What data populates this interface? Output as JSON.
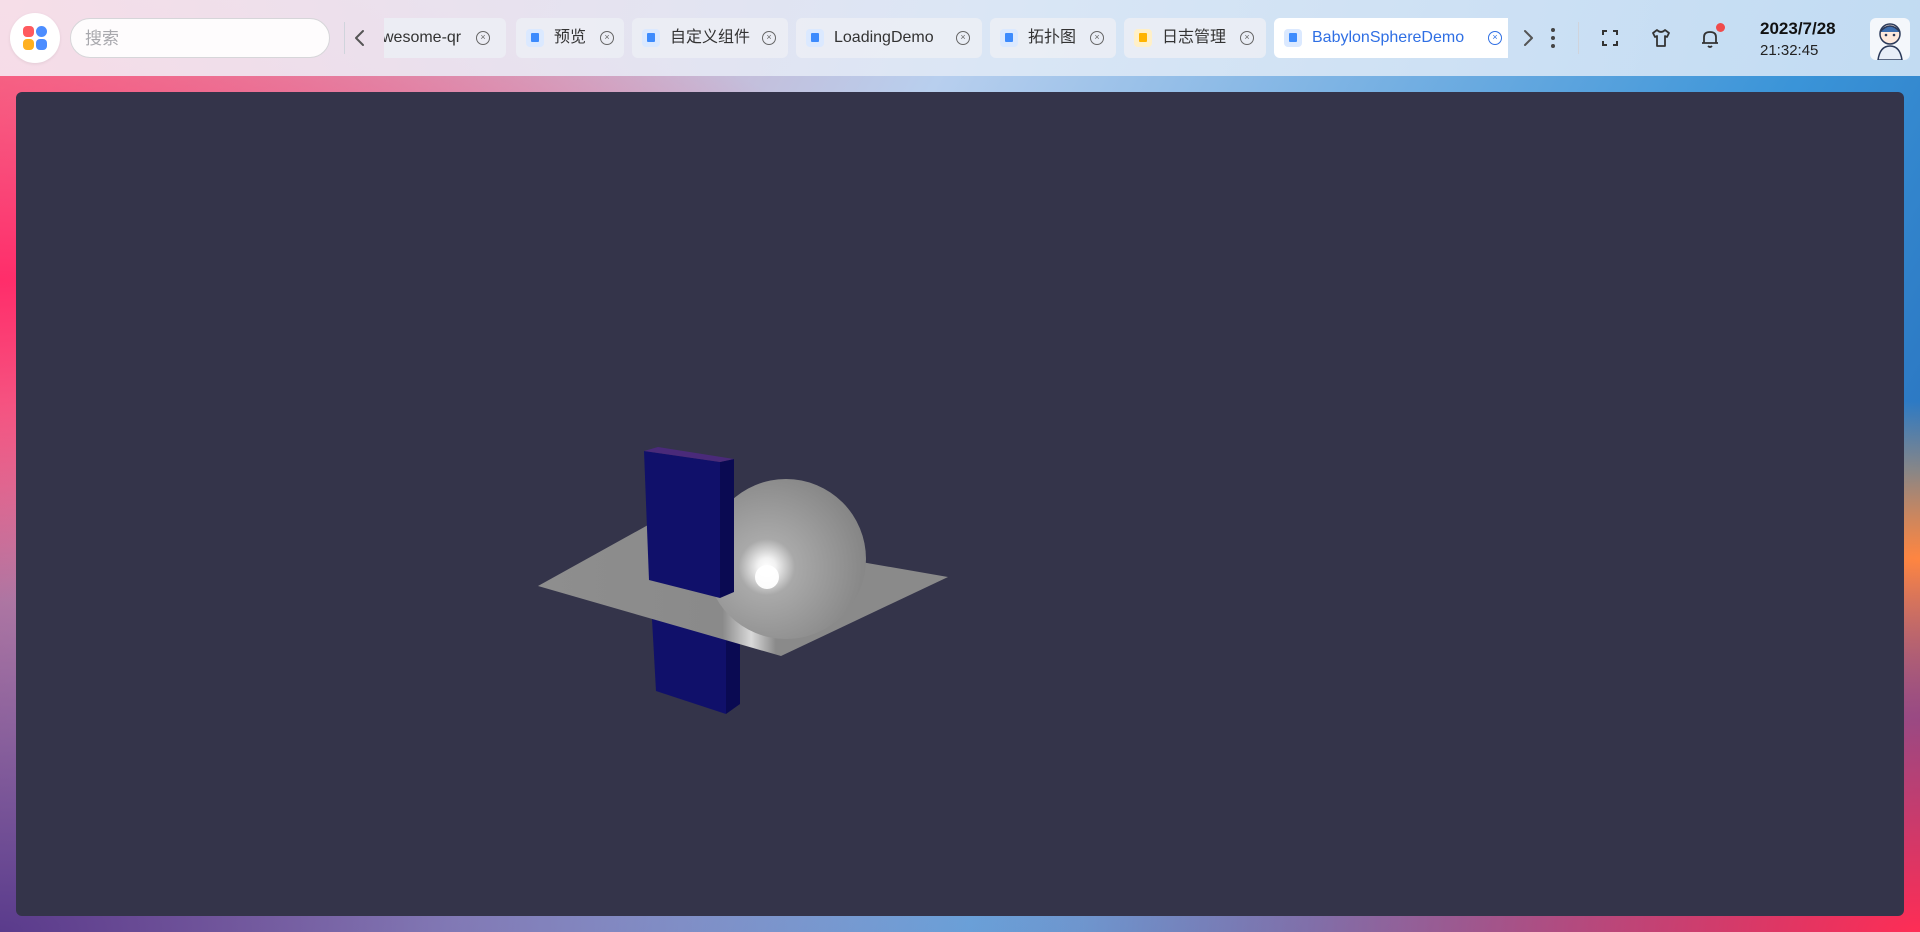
{
  "search": {
    "placeholder": "搜索"
  },
  "tabs": [
    {
      "label": "wesome-qr",
      "icon": "none"
    },
    {
      "label": "预览",
      "icon": "cube-icon"
    },
    {
      "label": "自定义组件",
      "icon": "cube-icon"
    },
    {
      "label": "LoadingDemo",
      "icon": "cube-icon"
    },
    {
      "label": "拓扑图",
      "icon": "cube-icon"
    },
    {
      "label": "日志管理",
      "icon": "log-icon"
    },
    {
      "label": "BabylonSphereDemo",
      "icon": "cube-icon",
      "active": true
    }
  ],
  "header": {
    "date": "2023/7/28",
    "time": "21:32:45"
  },
  "colors": {
    "accent": "#2f6fe4",
    "viewport_bg": "#34344a",
    "notification_dot": "#f04b4b"
  }
}
